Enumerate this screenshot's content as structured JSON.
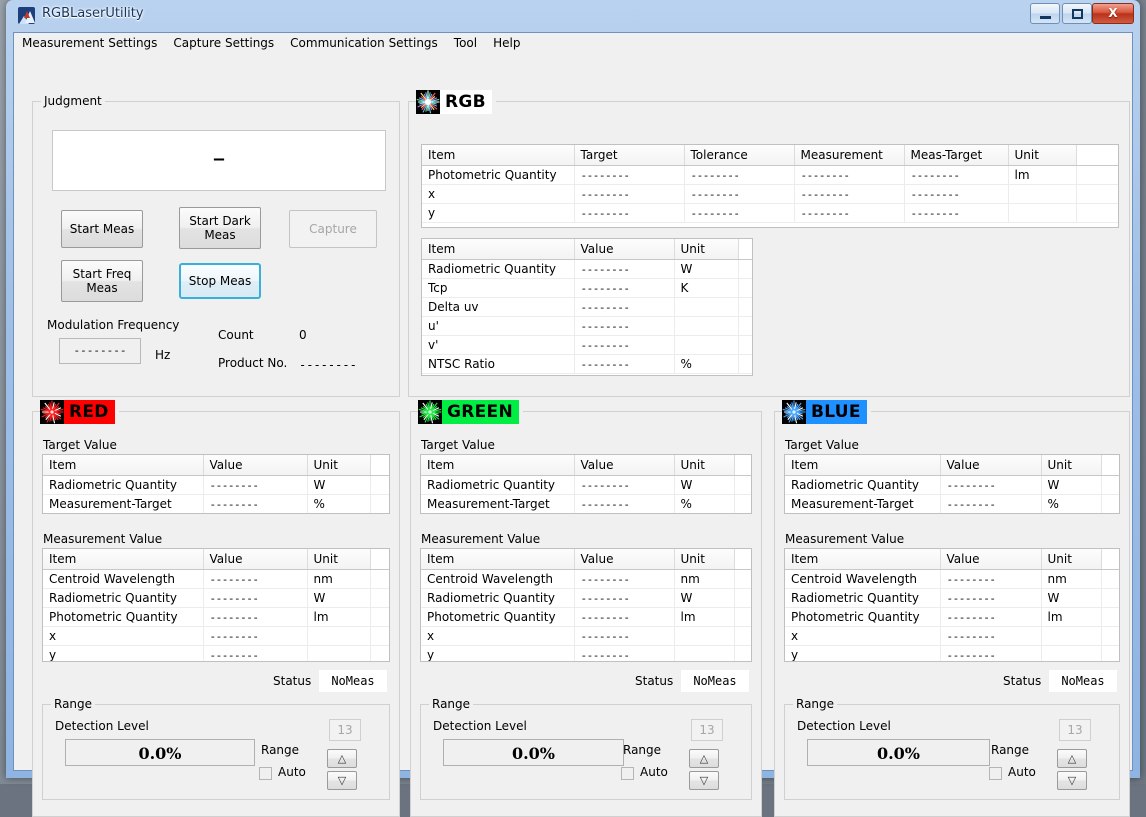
{
  "window": {
    "title": "RGBLaserUtility",
    "icon": "app-mountain-icon",
    "buttons": {
      "minimize": "–",
      "maximize": "□",
      "close": "X"
    }
  },
  "menubar": {
    "items": [
      {
        "label": "Measurement Settings"
      },
      {
        "label": "Capture Settings"
      },
      {
        "label": "Communication Settings"
      },
      {
        "label": "Tool"
      },
      {
        "label": "Help"
      }
    ]
  },
  "judgment": {
    "group_label": "Judgment",
    "display_value": "—",
    "buttons": {
      "start_meas": "Start Meas",
      "start_dark_meas": "Start Dark\nMeas",
      "capture": "Capture",
      "start_freq_meas": "Start Freq\nMeas",
      "stop_meas": "Stop Meas"
    },
    "modulation_frequency_label": "Modulation Frequency",
    "modulation_frequency_value": "--------",
    "modulation_frequency_unit": "Hz",
    "count_label": "Count",
    "count_value": "0",
    "product_no_label": "Product No.",
    "product_no_value": "--------"
  },
  "rgb": {
    "title": "RGB",
    "badge_bg": "#ffffff",
    "badge_fg": "#000000",
    "main_table": {
      "headers": [
        "Item",
        "Target",
        "Tolerance",
        "Measurement",
        "Meas-Target",
        "Unit",
        ""
      ],
      "rows": [
        [
          "Photometric Quantity",
          "--------",
          "--------",
          "--------",
          "--------",
          "lm",
          ""
        ],
        [
          "x",
          "--------",
          "--------",
          "--------",
          "--------",
          "",
          ""
        ],
        [
          "y",
          "--------",
          "--------",
          "--------",
          "--------",
          "",
          ""
        ]
      ]
    },
    "sub_table": {
      "headers": [
        "Item",
        "Value",
        "Unit",
        ""
      ],
      "rows": [
        [
          "Radiometric Quantity",
          "--------",
          "W",
          ""
        ],
        [
          "Tcp",
          "--------",
          "K",
          ""
        ],
        [
          "Delta uv",
          "--------",
          "",
          ""
        ],
        [
          "u'",
          "--------",
          "",
          ""
        ],
        [
          "v'",
          "--------",
          "",
          ""
        ],
        [
          "NTSC Ratio",
          "--------",
          "%",
          ""
        ]
      ]
    }
  },
  "channels": [
    {
      "key": "red",
      "title": "RED",
      "badge_bg": "#ff0000",
      "badge_fg": "#000000",
      "icon_color": "#ff2020",
      "target_label": "Target Value",
      "measurement_label": "Measurement Value",
      "target_table": {
        "headers": [
          "Item",
          "Value",
          "Unit",
          ""
        ],
        "rows": [
          [
            "Radiometric Quantity",
            "--------",
            "W",
            ""
          ],
          [
            "Measurement-Target",
            "--------",
            "%",
            ""
          ]
        ]
      },
      "measurement_table": {
        "headers": [
          "Item",
          "Value",
          "Unit",
          ""
        ],
        "rows": [
          [
            "Centroid Wavelength",
            "--------",
            "nm",
            ""
          ],
          [
            "Radiometric Quantity",
            "--------",
            "W",
            ""
          ],
          [
            "Photometric Quantity",
            "--------",
            "lm",
            ""
          ],
          [
            "x",
            "--------",
            "",
            ""
          ],
          [
            "y",
            "--------",
            "",
            ""
          ]
        ]
      },
      "status_label": "Status",
      "status_value": "NoMeas",
      "range": {
        "group_label": "Range",
        "detection_level_label": "Detection Level",
        "detection_level_value": "0.0%",
        "range_label": "Range",
        "range_value": "13",
        "auto_label": "Auto",
        "auto_checked": false,
        "up_glyph": "△",
        "down_glyph": "▽"
      }
    },
    {
      "key": "green",
      "title": "GREEN",
      "badge_bg": "#00ee44",
      "badge_fg": "#000000",
      "icon_color": "#22ee44",
      "target_label": "Target Value",
      "measurement_label": "Measurement Value",
      "target_table": {
        "headers": [
          "Item",
          "Value",
          "Unit",
          ""
        ],
        "rows": [
          [
            "Radiometric Quantity",
            "--------",
            "W",
            ""
          ],
          [
            "Measurement-Target",
            "--------",
            "%",
            ""
          ]
        ]
      },
      "measurement_table": {
        "headers": [
          "Item",
          "Value",
          "Unit",
          ""
        ],
        "rows": [
          [
            "Centroid Wavelength",
            "--------",
            "nm",
            ""
          ],
          [
            "Radiometric Quantity",
            "--------",
            "W",
            ""
          ],
          [
            "Photometric Quantity",
            "--------",
            "lm",
            ""
          ],
          [
            "x",
            "--------",
            "",
            ""
          ],
          [
            "y",
            "--------",
            "",
            ""
          ]
        ]
      },
      "status_label": "Status",
      "status_value": "NoMeas",
      "range": {
        "group_label": "Range",
        "detection_level_label": "Detection Level",
        "detection_level_value": "0.0%",
        "range_label": "Range",
        "range_value": "13",
        "auto_label": "Auto",
        "auto_checked": false,
        "up_glyph": "△",
        "down_glyph": "▽"
      }
    },
    {
      "key": "blue",
      "title": "BLUE",
      "badge_bg": "#1e90ff",
      "badge_fg": "#000000",
      "icon_color": "#4aa8ff",
      "target_label": "Target Value",
      "measurement_label": "Measurement Value",
      "target_table": {
        "headers": [
          "Item",
          "Value",
          "Unit",
          ""
        ],
        "rows": [
          [
            "Radiometric Quantity",
            "--------",
            "W",
            ""
          ],
          [
            "Measurement-Target",
            "--------",
            "%",
            ""
          ]
        ]
      },
      "measurement_table": {
        "headers": [
          "Item",
          "Value",
          "Unit",
          ""
        ],
        "rows": [
          [
            "Centroid Wavelength",
            "--------",
            "nm",
            ""
          ],
          [
            "Radiometric Quantity",
            "--------",
            "W",
            ""
          ],
          [
            "Photometric Quantity",
            "--------",
            "lm",
            ""
          ],
          [
            "x",
            "--------",
            "",
            ""
          ],
          [
            "y",
            "--------",
            "",
            ""
          ]
        ]
      },
      "status_label": "Status",
      "status_value": "NoMeas",
      "range": {
        "group_label": "Range",
        "detection_level_label": "Detection Level",
        "detection_level_value": "0.0%",
        "range_label": "Range",
        "range_value": "13",
        "auto_label": "Auto",
        "auto_checked": false,
        "up_glyph": "△",
        "down_glyph": "▽"
      }
    }
  ]
}
